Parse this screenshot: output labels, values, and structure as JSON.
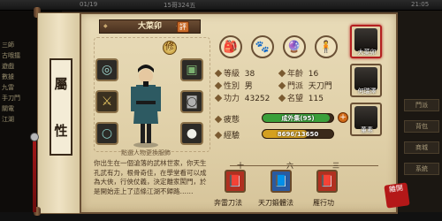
{
  "topbar": {
    "date": "01/19",
    "player": "15哥324五",
    "clock": "21:05"
  },
  "left_log": [
    "三師",
    "古哦擂",
    "遊戲",
    "數據",
    "九雷",
    "手刀門",
    "關電",
    "江湖"
  ],
  "background_buttons": [
    "門派",
    "背包",
    "商城",
    "系統"
  ],
  "scroll": {
    "char1": "屬",
    "char2": "性"
  },
  "character": {
    "name": "大菜卯",
    "rename_label": "評",
    "cultivate_icon": "修",
    "caption": "點選人物更換服飾",
    "description": "你出生在一個滄落的武林世家，你天生孔武有力，根骨奇佳，在學堂看可以成為大俠，行俠仗義，決定離家闖門，於是開始走上了這條江湖不歸路……"
  },
  "equipment": {
    "left": [
      "bracelet-icon",
      "sword-icon",
      "ring-icon"
    ],
    "right": [
      "mask-icon",
      "armor-icon",
      "pearl-icon"
    ]
  },
  "top_icons": [
    "backpack-icon",
    "pet-icon",
    "orb-icon",
    "figure-icon"
  ],
  "stats": {
    "level": {
      "label": "等級",
      "value": "38"
    },
    "age": {
      "label": "年齡",
      "value": "16"
    },
    "gender": {
      "label": "性別",
      "value": "男"
    },
    "sect": {
      "label": "門派",
      "value": "天刀門"
    },
    "power": {
      "label": "功力",
      "value": "43252"
    },
    "fame": {
      "label": "名望",
      "value": "115"
    }
  },
  "bars": {
    "fatigue": {
      "label": "疲態",
      "text": "成外集(95)",
      "percent": 95,
      "color": "#3aa03a"
    },
    "exp": {
      "label": "經驗",
      "text": "8696/13650",
      "percent": 64,
      "color": "#d4a020"
    }
  },
  "skills": [
    {
      "num": "",
      "name": "奔雷刀法",
      "color": "#b03020",
      "icon": "book-icon"
    },
    {
      "num": "六",
      "name": "天刀鍛體法",
      "color": "#2a5aa0",
      "icon": "book-icon"
    },
    {
      "num": "三",
      "name": "雁行功",
      "color": "#b03020",
      "icon": "book-icon"
    }
  ],
  "skill_header_nums": [
    "十",
    "六",
    "三"
  ],
  "party": [
    {
      "name": "大菜卯",
      "active": true
    },
    {
      "name": "何瑞澤",
      "active": false
    },
    {
      "name": "董素",
      "active": false
    }
  ],
  "close_label": "離開"
}
